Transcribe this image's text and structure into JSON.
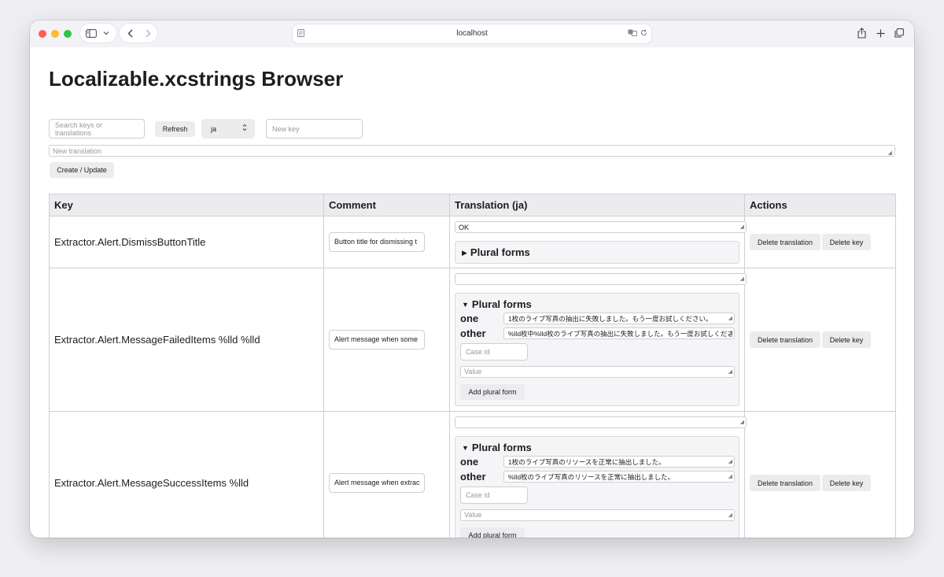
{
  "browser": {
    "url": "localhost"
  },
  "page": {
    "title": "Localizable.xcstrings Browser",
    "search_placeholder": "Search keys or translations",
    "refresh_label": "Refresh",
    "language_selected": "ja",
    "new_key_placeholder": "New key",
    "new_translation_placeholder": "New translation",
    "create_update_label": "Create / Update"
  },
  "table": {
    "headers": {
      "key": "Key",
      "comment": "Comment",
      "translation": "Translation (ja)",
      "actions": "Actions"
    },
    "plural_forms_label": "Plural forms",
    "case_id_placeholder": "Case id",
    "value_placeholder": "Value",
    "add_plural_label": "Add plural form",
    "delete_translation_label": "Delete translation",
    "delete_key_label": "Delete key",
    "rows": [
      {
        "key": "Extractor.Alert.DismissButtonTitle",
        "comment": "Button title for dismissing t",
        "translation": "OK",
        "plural_expanded": false,
        "plurals": []
      },
      {
        "key": "Extractor.Alert.MessageFailedItems %lld %lld",
        "comment": "Alert message when some",
        "translation": "",
        "plural_expanded": true,
        "plurals": [
          {
            "form": "one",
            "value": "1枚のライブ写真の抽出に失敗しました。もう一度お試しください。"
          },
          {
            "form": "other",
            "value": "%lld枚中%lld枚のライブ写真の抽出に失敗しました。もう一度お試しくださ"
          }
        ]
      },
      {
        "key": "Extractor.Alert.MessageSuccessItems %lld",
        "comment": "Alert message when extrac",
        "translation": "",
        "plural_expanded": true,
        "plurals": [
          {
            "form": "one",
            "value": "1枚のライブ写真のリソースを正常に抽出しました。"
          },
          {
            "form": "other",
            "value": "%lld枚のライブ写真のリソースを正常に抽出しました。"
          }
        ]
      }
    ]
  }
}
